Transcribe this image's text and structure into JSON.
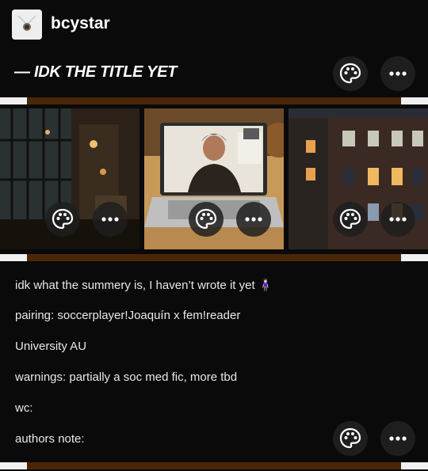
{
  "post": {
    "blog_name": "bcystar",
    "title": "— IDK THE TITLE YET",
    "lines": [
      "idk what the summery is, I haven’t wrote it yet 🧍🏻‍♀️",
      "pairing: soccerplayer!Joaquín x fem!reader",
      "University AU",
      "warnings: partially a soc med fic, more tbd",
      "wc:",
      "authors note:"
    ]
  },
  "icons": {
    "palette": "palette-icon",
    "more": "more-dots-icon"
  },
  "colors": {
    "background": "#0a0a0a",
    "accent_strip": "#4a2608",
    "button_bg": "#1e1e1e"
  }
}
